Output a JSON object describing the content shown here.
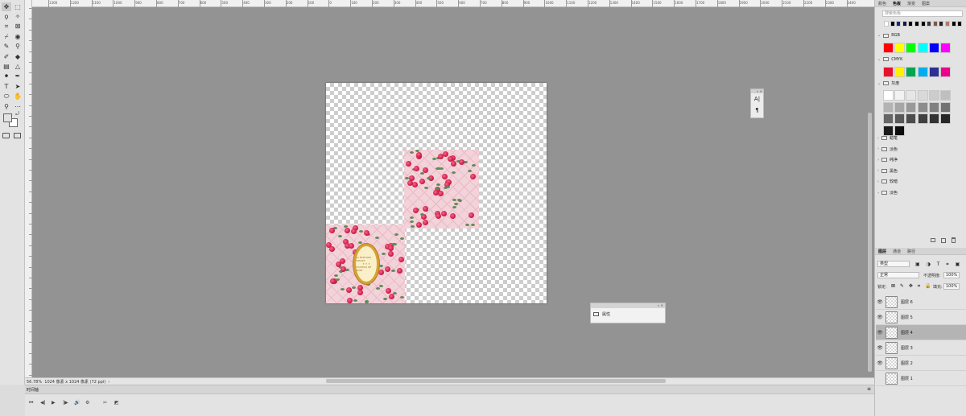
{
  "toolbar": {
    "tools": [
      {
        "name": "move-tool",
        "glyph": "✥"
      },
      {
        "name": "marquee-tool",
        "glyph": "⬚"
      },
      {
        "name": "lasso-tool",
        "glyph": "ϙ"
      },
      {
        "name": "magic-wand-tool",
        "glyph": "✧"
      },
      {
        "name": "crop-tool",
        "glyph": "⌗"
      },
      {
        "name": "frame-tool",
        "glyph": "⊠"
      },
      {
        "name": "eyedropper-tool",
        "glyph": "⌿"
      },
      {
        "name": "healing-tool",
        "glyph": "◉"
      },
      {
        "name": "brush-tool",
        "glyph": "✎"
      },
      {
        "name": "stamp-tool",
        "glyph": "⚲"
      },
      {
        "name": "history-brush-tool",
        "glyph": "✐"
      },
      {
        "name": "eraser-tool",
        "glyph": "◆"
      },
      {
        "name": "gradient-tool",
        "glyph": "▤"
      },
      {
        "name": "blur-tool",
        "glyph": "△"
      },
      {
        "name": "dodge-tool",
        "glyph": "⚫"
      },
      {
        "name": "pen-tool",
        "glyph": "✒"
      },
      {
        "name": "type-tool",
        "glyph": "T"
      },
      {
        "name": "path-select-tool",
        "glyph": "➤"
      },
      {
        "name": "shape-tool",
        "glyph": "⬭"
      },
      {
        "name": "hand-tool",
        "glyph": "✋"
      },
      {
        "name": "zoom-tool",
        "glyph": "⚲"
      },
      {
        "name": "more-tools",
        "glyph": "⋯"
      }
    ]
  },
  "ruler": {
    "h_labels": [
      "1300",
      "1200",
      "1100",
      "1000",
      "900",
      "800",
      "700",
      "600",
      "500",
      "400",
      "300",
      "200",
      "100",
      "0",
      "100",
      "200",
      "300",
      "400",
      "500",
      "600",
      "700",
      "800",
      "900",
      "1000",
      "1100",
      "1200",
      "1300",
      "1400",
      "1500",
      "1600",
      "1700",
      "1800",
      "1900",
      "2000",
      "2100",
      "2200",
      "2300",
      "2400"
    ]
  },
  "status": {
    "zoom": "56.78%",
    "info": "1024 像素 x 1024 像素 (72 ppi)",
    "arrow": "›"
  },
  "timeline": {
    "tab": "时间轴",
    "menu": "≡",
    "controls": [
      "⏮",
      "◀|",
      "▶",
      "|▶",
      "🔊",
      "⚙",
      "✂",
      "◩"
    ]
  },
  "float_tools": {
    "items": [
      "A|",
      "¶"
    ],
    "close": "»  ✕"
  },
  "properties": {
    "close": "»  ✕",
    "label": "属性"
  },
  "panel": {
    "top_tabs": [
      "颜色",
      "色板",
      "渐变",
      "图案"
    ],
    "search_placeholder": "搜索色板",
    "recent_colors": [
      "#ffffff",
      "#000000",
      "#1a2a7a",
      "#0b1a4a",
      "#000000",
      "#000000",
      "#000000",
      "#3a3a3a",
      "#7a5a4a",
      "#222222",
      "#b07a6a",
      "#000000",
      "#000000"
    ],
    "groups": [
      {
        "name": "RGB",
        "colors": [
          "#ff0000",
          "#ffff00",
          "#00ff00",
          "#00ffff",
          "#0000ff",
          "#ff00ff"
        ]
      },
      {
        "name": "CMYK",
        "colors": [
          "#e8112d",
          "#fff200",
          "#00a651",
          "#00aeef",
          "#2e3192",
          "#ec008c"
        ]
      },
      {
        "name": "灰度",
        "colors": [
          "#ffffff",
          "#f2f2f2",
          "#e6e6e6",
          "#d9d9d9",
          "#cccccc",
          "#bfbfbf",
          "#b3b3b3",
          "#a6a6a6",
          "#999999",
          "#8c8c8c",
          "#808080",
          "#737373",
          "#666666",
          "#595959",
          "#4d4d4d",
          "#404040",
          "#333333",
          "#262626",
          "#1a1a1a",
          "#0d0d0d"
        ]
      }
    ],
    "folders": [
      "蜡笔",
      "淡色",
      "纯净",
      "黑色",
      "较暗",
      "淡色"
    ],
    "layers_tabs": [
      "图层",
      "通道",
      "路径"
    ],
    "kind_label": "类型",
    "blend_mode": "正常",
    "opacity_label": "不透明度:",
    "opacity_value": "100%",
    "lock_label": "锁定:",
    "fill_label": "填充:",
    "fill_value": "100%",
    "layers": [
      {
        "name": "图层 6",
        "visible": true,
        "selected": false
      },
      {
        "name": "图层 5",
        "visible": true,
        "selected": false
      },
      {
        "name": "图层 4",
        "visible": true,
        "selected": true
      },
      {
        "name": "图层 3",
        "visible": true,
        "selected": false
      },
      {
        "name": "图层 2",
        "visible": true,
        "selected": false
      },
      {
        "name": "图层 1",
        "visible": false,
        "selected": false
      }
    ]
  },
  "document": {
    "cameo_lines": [
      "LA FETE DES FLEURS",
      "✦ ✦ ✦",
      "CHATEAU DE ROSE"
    ]
  },
  "colors": {
    "canvas_bg": "#939393",
    "pink_tile": "#f3d3da",
    "rose": "#d41f4e",
    "gold": "#d6a234"
  }
}
